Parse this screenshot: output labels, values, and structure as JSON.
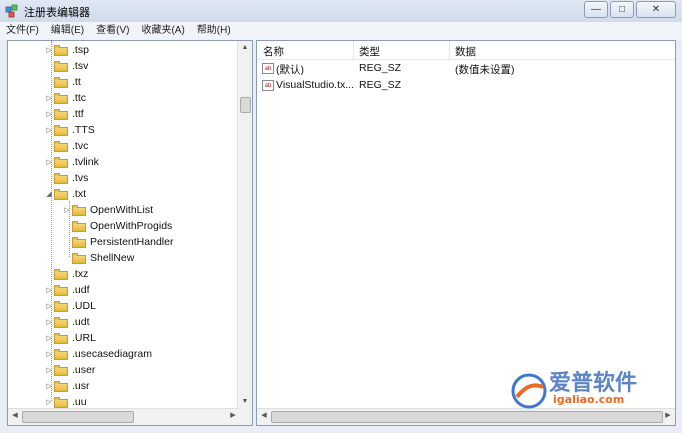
{
  "window": {
    "title": "注册表编辑器",
    "minimize": "—",
    "maximize": "□",
    "close": "✕"
  },
  "menu": [
    "文件(F)",
    "编辑(E)",
    "查看(V)",
    "收藏夹(A)",
    "帮助(H)"
  ],
  "tree": {
    "items": [
      {
        "label": ".tsp",
        "expander": "▷",
        "level": 0
      },
      {
        "label": ".tsv",
        "expander": "",
        "level": 0
      },
      {
        "label": ".tt",
        "expander": "",
        "level": 0
      },
      {
        "label": ".ttc",
        "expander": "▷",
        "level": 0
      },
      {
        "label": ".ttf",
        "expander": "▷",
        "level": 0
      },
      {
        "label": ".TTS",
        "expander": "▷",
        "level": 0
      },
      {
        "label": ".tvc",
        "expander": "",
        "level": 0
      },
      {
        "label": ".tvlink",
        "expander": "▷",
        "level": 0
      },
      {
        "label": ".tvs",
        "expander": "",
        "level": 0
      },
      {
        "label": ".txt",
        "expander": "◢",
        "level": 0
      },
      {
        "label": "OpenWithList",
        "expander": "▷",
        "level": 1
      },
      {
        "label": "OpenWithProgids",
        "expander": "",
        "level": 1
      },
      {
        "label": "PersistentHandler",
        "expander": "",
        "level": 1
      },
      {
        "label": "ShellNew",
        "expander": "",
        "level": 1
      },
      {
        "label": ".txz",
        "expander": "",
        "level": 0
      },
      {
        "label": ".udf",
        "expander": "▷",
        "level": 0
      },
      {
        "label": ".UDL",
        "expander": "▷",
        "level": 0
      },
      {
        "label": ".udt",
        "expander": "▷",
        "level": 0
      },
      {
        "label": ".URL",
        "expander": "▷",
        "level": 0
      },
      {
        "label": ".usecasediagram",
        "expander": "▷",
        "level": 0
      },
      {
        "label": ".user",
        "expander": "▷",
        "level": 0
      },
      {
        "label": ".usr",
        "expander": "▷",
        "level": 0
      },
      {
        "label": ".uu",
        "expander": "▷",
        "level": 0
      }
    ]
  },
  "values": {
    "columns": {
      "name": "名称",
      "type": "类型",
      "data": "数据"
    },
    "rows": [
      {
        "icon": "ab",
        "name": "(默认)",
        "type": "REG_SZ",
        "data": "(数值未设置)"
      },
      {
        "icon": "ab",
        "name": "VisualStudio.tx...",
        "type": "REG_SZ",
        "data": ""
      }
    ]
  },
  "watermark": {
    "brand": "爱普软件",
    "url": "igaliao.com"
  }
}
